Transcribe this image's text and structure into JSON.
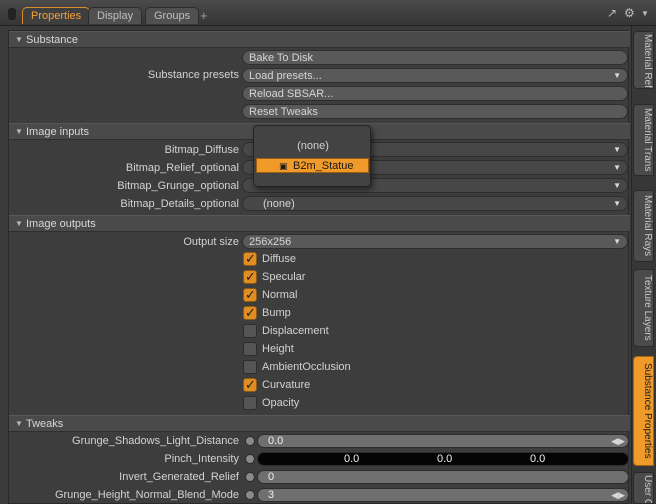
{
  "tabs": [
    "Properties",
    "Display",
    "Groups"
  ],
  "tab_add": "+",
  "toolbar": {
    "expand_icon": "expand-icon",
    "gear_icon": "gear-icon",
    "menu_icon": "chevron-down-icon"
  },
  "substance": {
    "title": "Substance",
    "bake_label": "Bake To Disk",
    "presets_label": "Substance presets",
    "presets_value": "Load presets...",
    "reload_label": "Reload SBSAR...",
    "reset_label": "Reset Tweaks"
  },
  "image_inputs": {
    "title": "Image inputs",
    "rows": [
      {
        "label": "Bitmap_Diffuse",
        "value": ""
      },
      {
        "label": "Bitmap_Relief_optional",
        "value": ""
      },
      {
        "label": "Bitmap_Grunge_optional",
        "value": ""
      },
      {
        "label": "Bitmap_Details_optional",
        "value": "(none)"
      }
    ]
  },
  "popup": {
    "none": "(none)",
    "selected": "B2m_Statue"
  },
  "image_outputs": {
    "title": "Image outputs",
    "output_size_label": "Output size",
    "output_size_value": "256x256",
    "checks": [
      {
        "label": "Diffuse",
        "checked": true
      },
      {
        "label": "Specular",
        "checked": true
      },
      {
        "label": "Normal",
        "checked": true
      },
      {
        "label": "Bump",
        "checked": true
      },
      {
        "label": "Displacement",
        "checked": false
      },
      {
        "label": "Height",
        "checked": false
      },
      {
        "label": "AmbientOcclusion",
        "checked": false
      },
      {
        "label": "Curvature",
        "checked": true
      },
      {
        "label": "Opacity",
        "checked": false
      }
    ]
  },
  "tweaks": {
    "title": "Tweaks",
    "rows": [
      {
        "label": "Grunge_Shadows_Light_Distance",
        "value": "0.0"
      },
      {
        "label": "Pinch_Intensity",
        "values": [
          "0.0",
          "0.0",
          "0.0"
        ]
      },
      {
        "label": "Invert_Generated_Relief",
        "value": "0"
      },
      {
        "label": "Grunge_Height_Normal_Blend_Mode",
        "value": "3"
      }
    ]
  },
  "side_tabs": [
    "Material Ref",
    "Material Trans",
    "Material Rays",
    "Texture Layers",
    "Substance Properties",
    "User C"
  ],
  "colors": {
    "accent": "#f09a2a",
    "background": "#3b3b3b"
  }
}
